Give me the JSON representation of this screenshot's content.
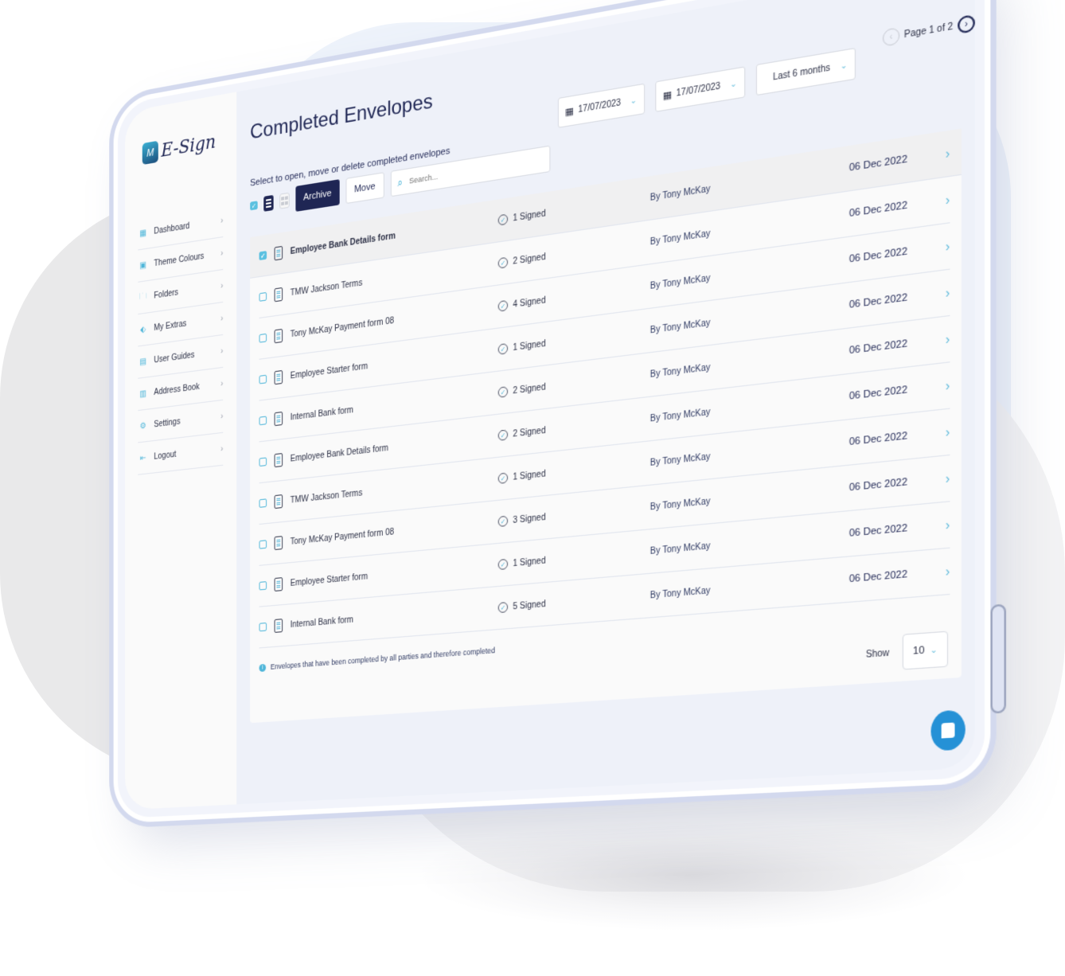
{
  "app": {
    "logo_text": "E-Sign",
    "logo_badge": "M"
  },
  "sidebar": {
    "items": [
      {
        "label": "Dashboard",
        "icon": "dashboard-icon",
        "glyph": "▦"
      },
      {
        "label": "Theme Colours",
        "icon": "palette-icon",
        "glyph": "▣"
      },
      {
        "label": "Folders",
        "icon": "folder-icon",
        "glyph": "🗀"
      },
      {
        "label": "My Extras",
        "icon": "tag-icon",
        "glyph": "⬖"
      },
      {
        "label": "User Guides",
        "icon": "book-icon",
        "glyph": "▤"
      },
      {
        "label": "Address Book",
        "icon": "address-book-icon",
        "glyph": "▥"
      },
      {
        "label": "Settings",
        "icon": "gear-icon",
        "glyph": "⚙"
      },
      {
        "label": "Logout",
        "icon": "logout-icon",
        "glyph": "⇤"
      }
    ],
    "chevron": "›"
  },
  "main": {
    "title": "Completed Envelopes",
    "subtitle": "Select to open, move or delete completed envelopes",
    "toolbar": {
      "archive_label": "Archive",
      "move_label": "Move",
      "search_placeholder": "Search...",
      "search_value": ""
    },
    "filters": {
      "date_from": "17/07/2023",
      "date_to": "17/07/2023",
      "range": "Last 6 months"
    },
    "pager": {
      "text": "Page 1 of 2",
      "prev": "‹",
      "next": "›"
    },
    "rows": [
      {
        "name": "Employee Bank Details form",
        "signed": "1 Signed",
        "by": "By Tony McKay",
        "date": "06 Dec 2022",
        "checked": true
      },
      {
        "name": "TMW Jackson Terms",
        "signed": "2 Signed",
        "by": "By Tony McKay",
        "date": "06 Dec 2022",
        "checked": false
      },
      {
        "name": "Tony McKay Payment form 08",
        "signed": "4 Signed",
        "by": "By Tony McKay",
        "date": "06 Dec 2022",
        "checked": false
      },
      {
        "name": "Employee Starter form",
        "signed": "1 Signed",
        "by": "By Tony McKay",
        "date": "06 Dec 2022",
        "checked": false
      },
      {
        "name": "Internal Bank form",
        "signed": "2 Signed",
        "by": "By Tony McKay",
        "date": "06 Dec 2022",
        "checked": false
      },
      {
        "name": "Employee Bank Details form",
        "signed": "2 Signed",
        "by": "By Tony McKay",
        "date": "06 Dec 2022",
        "checked": false
      },
      {
        "name": "TMW Jackson Terms",
        "signed": "1 Signed",
        "by": "By Tony McKay",
        "date": "06 Dec 2022",
        "checked": false
      },
      {
        "name": "Tony McKay Payment form 08",
        "signed": "3 Signed",
        "by": "By Tony McKay",
        "date": "06 Dec 2022",
        "checked": false
      },
      {
        "name": "Employee Starter form",
        "signed": "1 Signed",
        "by": "By Tony McKay",
        "date": "06 Dec 2022",
        "checked": false
      },
      {
        "name": "Internal Bank form",
        "signed": "5 Signed",
        "by": "By Tony McKay",
        "date": "06 Dec 2022",
        "checked": false
      }
    ],
    "note": "Envelopes that have been completed by all parties and therefore completed",
    "show_label": "Show",
    "show_value": "10"
  },
  "colors": {
    "navy": "#1f2654",
    "accent": "#5ab8da",
    "chat": "#2591d6"
  }
}
